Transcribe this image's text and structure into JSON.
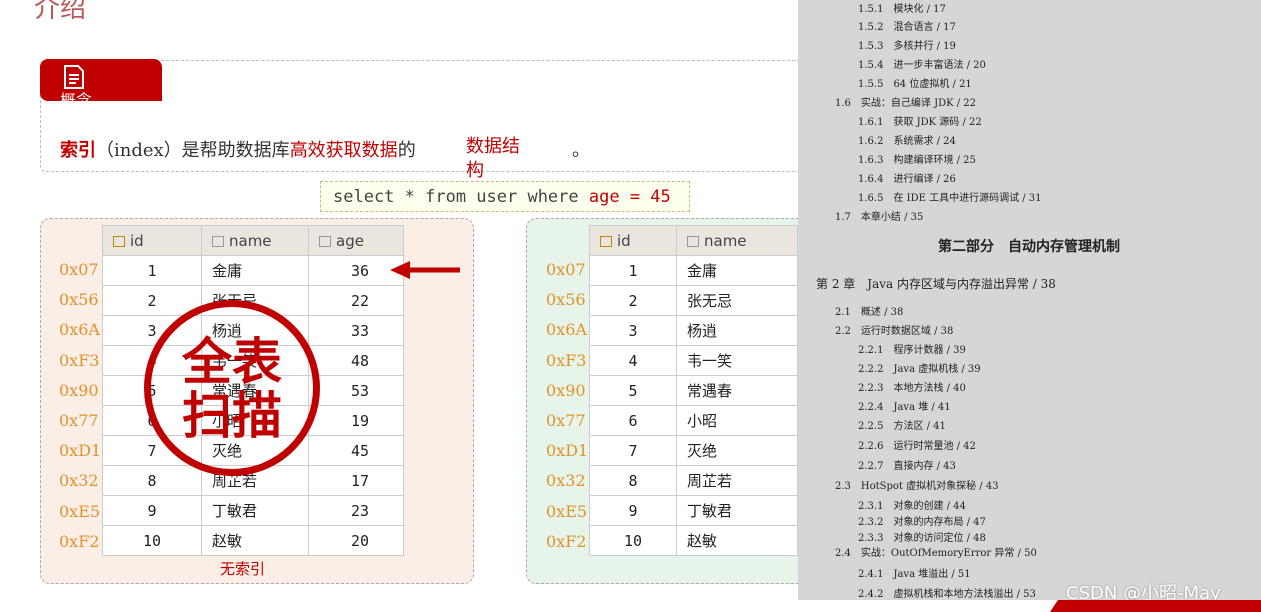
{
  "header": {
    "title": "介绍"
  },
  "concept": {
    "tab_label": "概念",
    "index_kw": "索引",
    "index_rest": "（index）是帮助数据库",
    "efficient": "高效获取数据",
    "tail": "的",
    "structure": "数据结构",
    "period": "。"
  },
  "sql": {
    "prefix": "select * from user where ",
    "condition": "age = 45"
  },
  "columns": {
    "id": "id",
    "name": "name",
    "age": "age"
  },
  "rows": [
    {
      "addr": "0x07",
      "id": "1",
      "name": "金庸",
      "age": "36"
    },
    {
      "addr": "0x56",
      "id": "2",
      "name": "张无忌",
      "age": "22"
    },
    {
      "addr": "0x6A",
      "id": "3",
      "name": "杨逍",
      "age": "33"
    },
    {
      "addr": "0xF3",
      "id": "4",
      "name": "韦一笑",
      "age": "48"
    },
    {
      "addr": "0x90",
      "id": "5",
      "name": "常遇春",
      "age": "53"
    },
    {
      "addr": "0x77",
      "id": "6",
      "name": "小昭",
      "age": "19"
    },
    {
      "addr": "0xD1",
      "id": "7",
      "name": "灭绝",
      "age": "45"
    },
    {
      "addr": "0x32",
      "id": "8",
      "name": "周芷若",
      "age": "17"
    },
    {
      "addr": "0xE5",
      "id": "9",
      "name": "丁敏君",
      "age": "23"
    },
    {
      "addr": "0xF2",
      "id": "10",
      "name": "赵敏",
      "age": "20"
    }
  ],
  "panel_left": {
    "caption": "无索引"
  },
  "stamp": {
    "line1": "全表",
    "line2": "扫描"
  },
  "book": {
    "part_title": "第二部分　自动内存管理机制",
    "chapter": "第 2 章　Java 内存区域与内存溢出异常 / 38",
    "toc": [
      "1.5.1　模块化 / 17",
      "1.5.2　混合语言 / 17",
      "1.5.3　多核并行 / 19",
      "1.5.4　进一步丰富语法 / 20",
      "1.5.5　64 位虚拟机 / 21",
      "1.6　实战：自己编译 JDK / 22",
      "1.6.1　获取 JDK 源码 / 22",
      "1.6.2　系统需求 / 24",
      "1.6.3　构建编译环境 / 25",
      "1.6.4　进行编译 / 26",
      "1.6.5　在 IDE 工具中进行源码调试 / 31",
      "1.7　本章小结 / 35",
      "2.1　概述 / 38",
      "2.2　运行时数据区域 / 38",
      "2.2.1　程序计数器 / 39",
      "2.2.2　Java 虚拟机栈 / 39",
      "2.2.3　本地方法栈 / 40",
      "2.2.4　Java 堆 / 41",
      "2.2.5　方法区 / 41",
      "2.2.6　运行时常量池 / 42",
      "2.2.7　直接内存 / 43",
      "2.3　HotSpot 虚拟机对象探秘 / 43",
      "2.3.1　对象的创建 / 44",
      "2.3.2　对象的内存布局 / 47",
      "2.3.3　对象的访问定位 / 48",
      "2.4　实战：OutOfMemoryError 异常 / 50",
      "2.4.1　Java 堆溢出 / 51",
      "2.4.2　虚拟机栈和本地方法栈溢出 / 53"
    ]
  },
  "watermark": "CSDN @小昭-May",
  "colors": {
    "accent": "#c00000",
    "address": "#e0932b",
    "left_panel": "#fbeee6",
    "right_panel": "#e6f4ea"
  }
}
